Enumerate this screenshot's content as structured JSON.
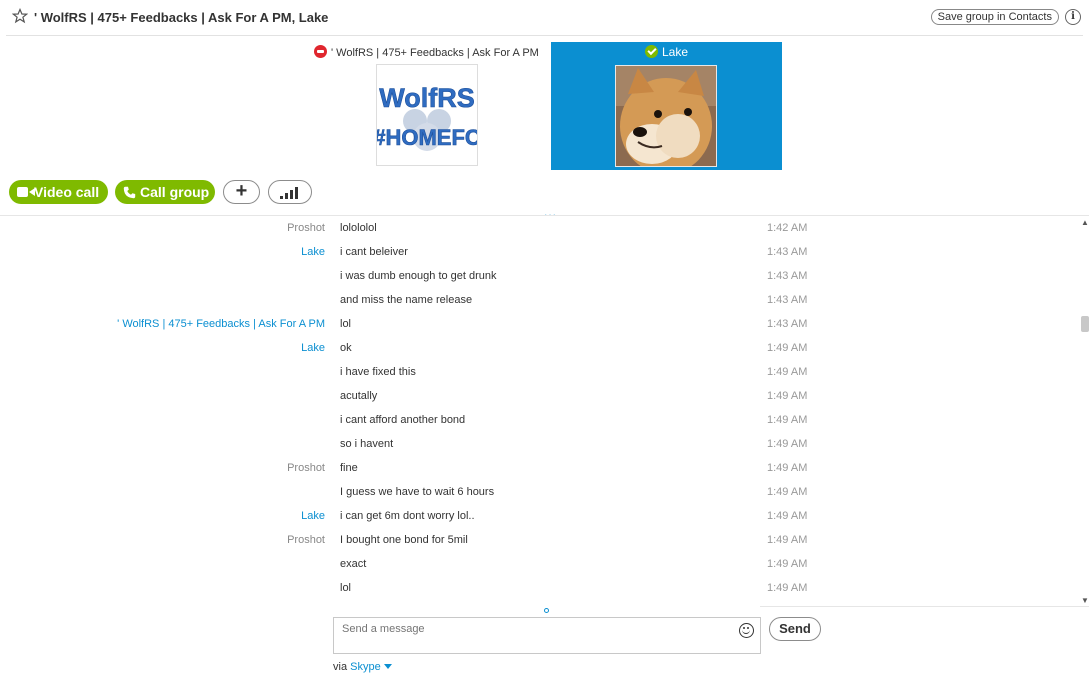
{
  "header": {
    "title": "' WolfRS | 475+ Feedbacks | Ask For A PM, Lake",
    "save_contacts_label": "Save group in Contacts",
    "info_label": "i"
  },
  "participants": [
    {
      "name": "' WolfRS | 475+ Feedbacks | Ask For A PM",
      "status": "offline",
      "avatar_text_1": "WolfRS",
      "avatar_text_2": "#HOMEFC"
    },
    {
      "name": "Lake",
      "status": "online",
      "avatar_menu": "▾"
    }
  ],
  "calls": {
    "video_label": "Video call",
    "call_group_label": "Call group",
    "add_label": "+"
  },
  "colors": {
    "accent": "#0b8fd1",
    "green": "#7fba00",
    "offline_red": "#e0262e"
  },
  "divider": "...",
  "messages": [
    {
      "sender": "Proshot",
      "text": "lolololol",
      "time": "1:42 AM"
    },
    {
      "sender": "Lake",
      "text": "i cant beleiver",
      "time": "1:43 AM"
    },
    {
      "sender": "",
      "text": "i was dumb enough to get drunk",
      "time": "1:43 AM"
    },
    {
      "sender": "",
      "text": "and miss the name release",
      "time": "1:43 AM"
    },
    {
      "sender": "' WolfRS | 475+ Feedbacks | Ask For A PM",
      "text": "lol",
      "time": "1:43 AM"
    },
    {
      "sender": "Lake",
      "text": "ok",
      "time": "1:49 AM"
    },
    {
      "sender": "",
      "text": "i have fixed this",
      "time": "1:49 AM"
    },
    {
      "sender": "",
      "text": "acutally",
      "time": "1:49 AM"
    },
    {
      "sender": "",
      "text": "i cant afford another bond",
      "time": "1:49 AM"
    },
    {
      "sender": "",
      "text": "so i havent",
      "time": "1:49 AM"
    },
    {
      "sender": "Proshot",
      "text": "fine",
      "time": "1:49 AM"
    },
    {
      "sender": "",
      "text": "I guess we have to wait 6 hours",
      "time": "1:49 AM"
    },
    {
      "sender": "Lake",
      "text": "i can get 6m dont worry lol..",
      "time": "1:49 AM"
    },
    {
      "sender": "Proshot",
      "text": "I bought one bond for 5mil",
      "time": "1:49 AM"
    },
    {
      "sender": "",
      "text": "exact",
      "time": "1:49 AM"
    },
    {
      "sender": "",
      "text": "lol",
      "time": "1:49 AM"
    }
  ],
  "composer": {
    "placeholder": "Send a message",
    "send_label": "Send",
    "via_prefix": "via",
    "via_link": "Skype"
  }
}
